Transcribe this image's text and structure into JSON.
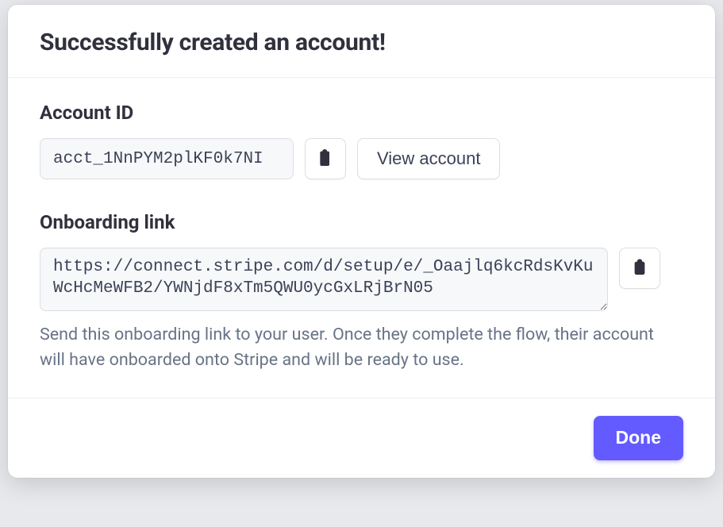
{
  "modal": {
    "title": "Successfully created an account!",
    "account_id": {
      "label": "Account ID",
      "value": "acct_1NnPYM2plKF0k7NI",
      "view_button": "View account"
    },
    "onboarding": {
      "label": "Onboarding link",
      "value": "https://connect.stripe.com/d/setup/e/_Oaajlq6kcRdsKvKuWcHcMeWFB2/YWNjdF8xTm5QWU0ycGxLRjBrN05",
      "helper": "Send this onboarding link to your user. Once they complete the flow, their account will have onboarded onto Stripe and will be ready to use."
    },
    "footer": {
      "done": "Done"
    }
  },
  "icons": {
    "clipboard": "clipboard-icon"
  },
  "colors": {
    "primary": "#635bff",
    "text": "#30313d",
    "muted": "#697386",
    "border": "#dcdee3",
    "input_bg": "#f7f8fa"
  }
}
